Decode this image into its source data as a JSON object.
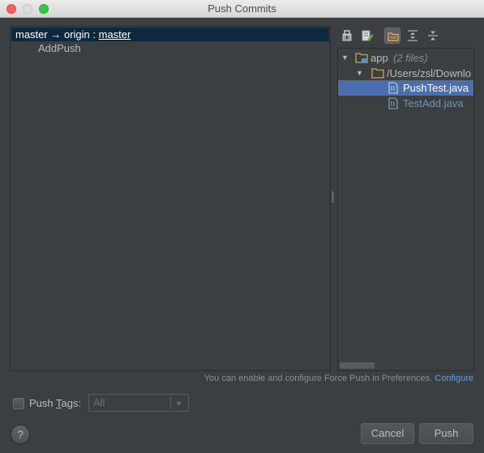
{
  "window": {
    "title": "Push Commits"
  },
  "commits": {
    "branch_local": "master",
    "branch_arrow": "→",
    "branch_remote_prefix": "origin : ",
    "branch_remote": "master",
    "commit_message": "AddPush"
  },
  "toolbar": {
    "icons": [
      "group-by-module-icon",
      "edit-source-icon",
      "group-by-directory-icon",
      "expand-all-icon",
      "collapse-all-icon"
    ]
  },
  "files": {
    "module_name": "app",
    "module_count": "(2 files)",
    "path": "/Users/zsl/Downlo",
    "items": [
      "PushTest.java",
      "TestAdd.java"
    ]
  },
  "info": {
    "text": "You can enable and configure Force Push in Preferences. ",
    "link": "Configure"
  },
  "tags": {
    "label_pre": "Push ",
    "label_mn": "T",
    "label_post": "ags:",
    "select_value": "All"
  },
  "buttons": {
    "help": "?",
    "cancel": "Cancel",
    "push": "Push"
  },
  "colors": {
    "background": "#3c3f41",
    "selection": "#4b6eaf",
    "branch_row": "#0d293e",
    "link": "#589df6",
    "modified_file": "#6897bb"
  }
}
